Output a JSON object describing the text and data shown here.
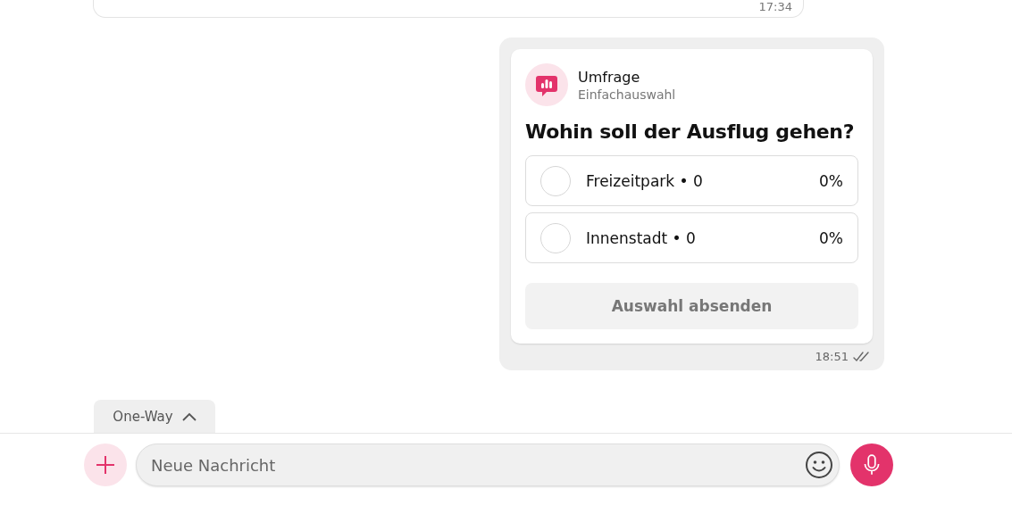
{
  "previous_message": {
    "time": "17:34"
  },
  "poll_message": {
    "type": "Umfrage",
    "mode": "Einfachauswahl",
    "question": "Wohin soll der Ausflug gehen?",
    "options": [
      {
        "label": "Freizeitpark • 0",
        "percent": "0%",
        "selected": false
      },
      {
        "label": "Innenstadt • 0",
        "percent": "0%",
        "selected": false
      }
    ],
    "submit": {
      "label": "Auswahl absenden",
      "disabled": true
    },
    "time": "18:51",
    "read": true
  },
  "mode_tab": {
    "label": "One-Way",
    "expanded": false
  },
  "composer": {
    "placeholder": "Neue Nachricht"
  }
}
